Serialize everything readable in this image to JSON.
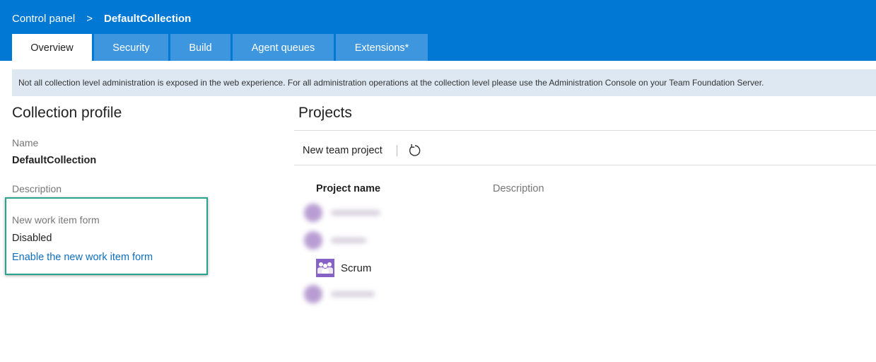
{
  "header": {
    "breadcrumb": {
      "root": "Control panel",
      "separator": ">",
      "current": "DefaultCollection"
    },
    "tabs": [
      {
        "label": "Overview",
        "active": true
      },
      {
        "label": "Security",
        "active": false
      },
      {
        "label": "Build",
        "active": false
      },
      {
        "label": "Agent queues",
        "active": false
      },
      {
        "label": "Extensions*",
        "active": false
      }
    ]
  },
  "banner": {
    "message": "Not all collection level administration is exposed in the web experience. For all administration operations at the collection level please use the Administration Console on your Team Foundation Server."
  },
  "collection_profile": {
    "title": "Collection profile",
    "name_label": "Name",
    "name_value": "DefaultCollection",
    "description_label": "Description",
    "work_item_form": {
      "label": "New work item form",
      "value": "Disabled",
      "link": "Enable the new work item form"
    }
  },
  "projects": {
    "title": "Projects",
    "new_project_label": "New team project",
    "refresh_icon": "refresh-icon",
    "columns": {
      "name": "Project name",
      "description": "Description"
    },
    "rows": [
      {
        "name": "",
        "blurred": true
      },
      {
        "name": "",
        "blurred": true
      },
      {
        "name": "Scrum",
        "blurred": false,
        "icon": "team-project-icon"
      },
      {
        "name": "",
        "blurred": true
      }
    ]
  },
  "colors": {
    "header_bg": "#0078d4",
    "tab_inactive": "#3d96de",
    "banner_bg": "#dde8f2",
    "link": "#106ebe",
    "highlight_border": "#27a48e",
    "project_icon": "#8661c5"
  }
}
